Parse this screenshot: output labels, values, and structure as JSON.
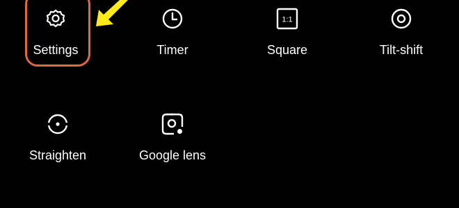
{
  "colors": {
    "background": "#000000",
    "text": "#ffffff",
    "highlight": "#e4683e",
    "arrow": "#ffeb1a"
  },
  "tiles": [
    {
      "label": "Settings",
      "icon": "gear-icon"
    },
    {
      "label": "Timer",
      "icon": "clock-icon"
    },
    {
      "label": "Square",
      "icon": "aspect-square-icon"
    },
    {
      "label": "Tilt-shift",
      "icon": "tilt-shift-icon"
    },
    {
      "label": "Straighten",
      "icon": "straighten-icon"
    },
    {
      "label": "Google lens",
      "icon": "google-lens-icon"
    }
  ],
  "square_icon_text": "1:1",
  "annotation": {
    "highlight_target": "Settings",
    "arrow_color": "#ffeb1a"
  }
}
